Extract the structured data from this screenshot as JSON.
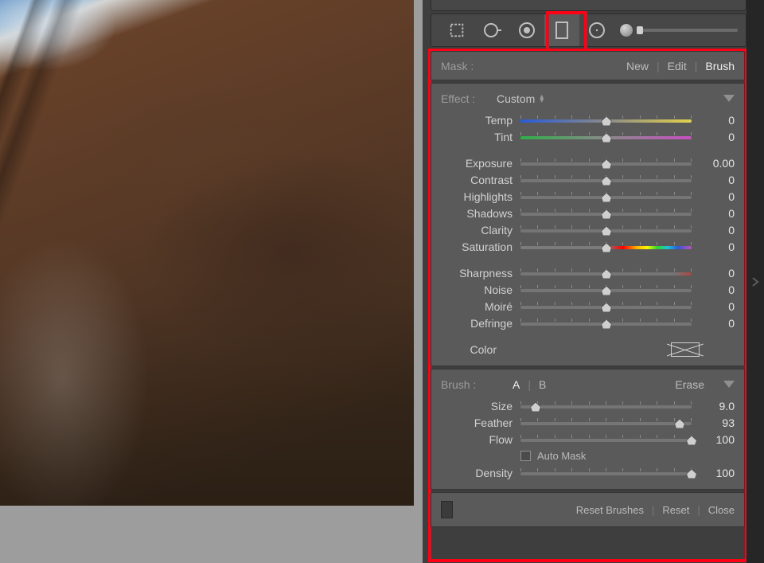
{
  "mask": {
    "label": "Mask :",
    "new": "New",
    "edit": "Edit",
    "brush": "Brush"
  },
  "effect": {
    "label": "Effect :",
    "preset": "Custom"
  },
  "sliders": {
    "temp": {
      "label": "Temp",
      "value": "0",
      "pos": 50,
      "grad": "grad-temp"
    },
    "tint": {
      "label": "Tint",
      "value": "0",
      "pos": 50,
      "grad": "grad-tint"
    },
    "exposure": {
      "label": "Exposure",
      "value": "0.00",
      "pos": 50
    },
    "contrast": {
      "label": "Contrast",
      "value": "0",
      "pos": 50
    },
    "highlights": {
      "label": "Highlights",
      "value": "0",
      "pos": 50
    },
    "shadows": {
      "label": "Shadows",
      "value": "0",
      "pos": 50
    },
    "clarity": {
      "label": "Clarity",
      "value": "0",
      "pos": 50
    },
    "saturation": {
      "label": "Saturation",
      "value": "0",
      "pos": 50,
      "grad": "grad-sat"
    },
    "sharpness": {
      "label": "Sharpness",
      "value": "0",
      "pos": 50,
      "grad": "grad-sharp"
    },
    "noise": {
      "label": "Noise",
      "value": "0",
      "pos": 50
    },
    "moire": {
      "label": "Moiré",
      "value": "0",
      "pos": 50
    },
    "defringe": {
      "label": "Defringe",
      "value": "0",
      "pos": 50
    }
  },
  "color": {
    "label": "Color"
  },
  "brush": {
    "label": "Brush :",
    "a": "A",
    "b": "B",
    "erase": "Erase",
    "size": {
      "label": "Size",
      "value": "9.0",
      "pos": 9
    },
    "feather": {
      "label": "Feather",
      "value": "93",
      "pos": 93
    },
    "flow": {
      "label": "Flow",
      "value": "100",
      "pos": 100
    },
    "automask": {
      "label": "Auto Mask"
    },
    "density": {
      "label": "Density",
      "value": "100",
      "pos": 100
    }
  },
  "footer": {
    "resetBrushes": "Reset Brushes",
    "reset": "Reset",
    "close": "Close"
  }
}
